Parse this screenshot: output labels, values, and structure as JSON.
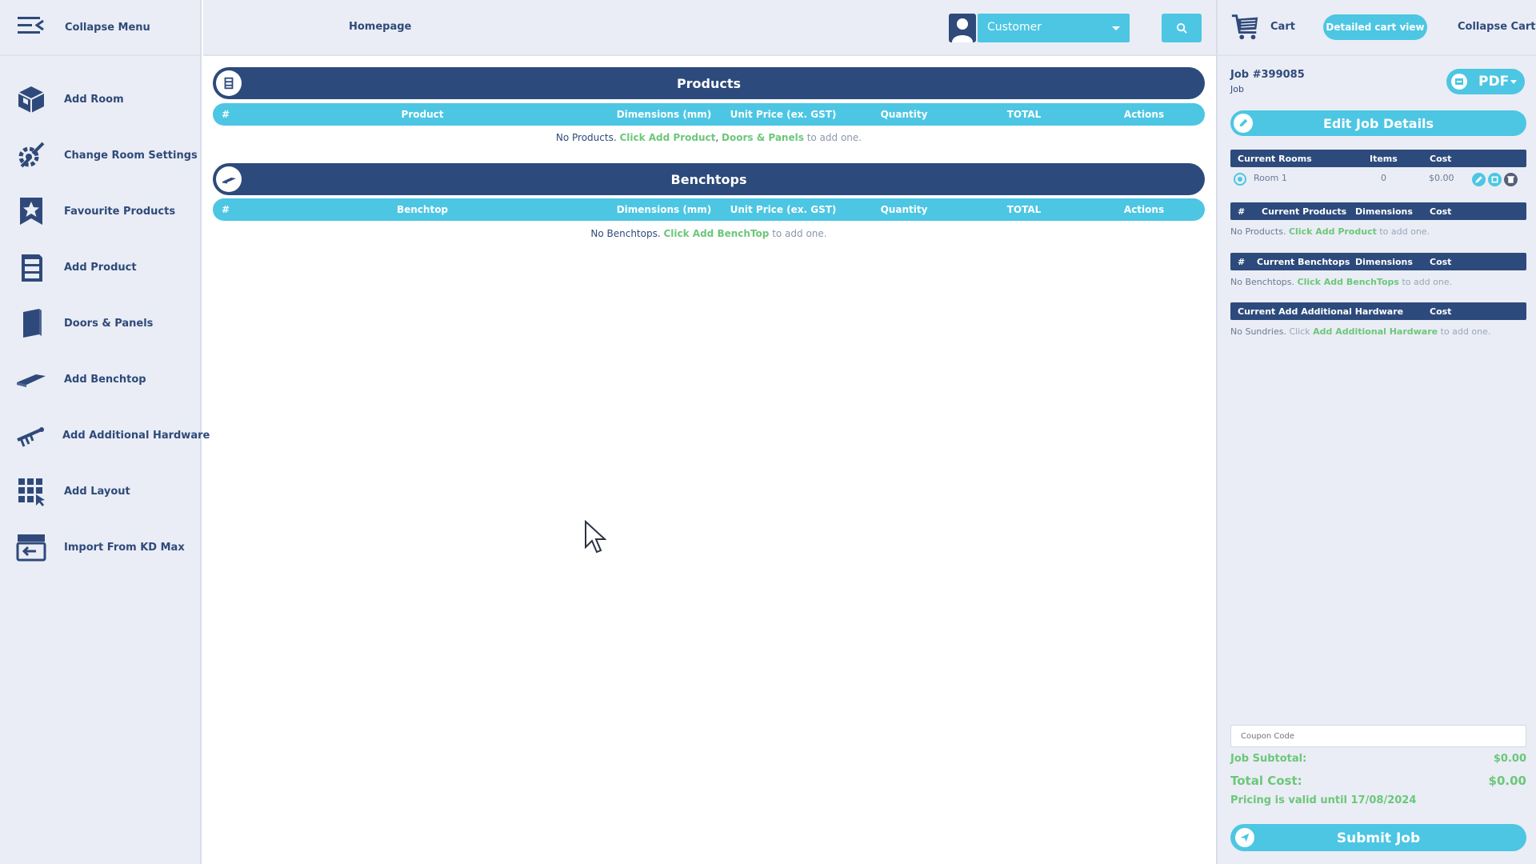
{
  "sidebar": {
    "collapse_label": "Collapse Menu",
    "items": [
      {
        "label": "Add Room",
        "icon": "cube-icon"
      },
      {
        "label": "Change Room Settings",
        "icon": "tools-icon"
      },
      {
        "label": "Favourite Products",
        "icon": "star-icon"
      },
      {
        "label": "Add Product",
        "icon": "cabinet-icon"
      },
      {
        "label": "Doors & Panels",
        "icon": "door-icon"
      },
      {
        "label": "Add Benchtop",
        "icon": "benchtop-icon"
      },
      {
        "label": "Add Additional Hardware",
        "icon": "hardware-icon"
      },
      {
        "label": "Add Layout",
        "icon": "grid-icon"
      },
      {
        "label": "Import From KD Max",
        "icon": "import-icon"
      }
    ]
  },
  "topbar": {
    "homepage": "Homepage",
    "customer_select": "Customer"
  },
  "products": {
    "title": "Products",
    "columns": [
      "#",
      "Product",
      "Dimensions (mm)",
      "Unit Price (ex. GST)",
      "Quantity",
      "TOTAL",
      "Actions"
    ],
    "empty": {
      "prefix": "No Products.",
      "link1": "Click Add Product",
      "sep": ",",
      "link2": "Doors & Panels",
      "suffix": "to add one."
    }
  },
  "benchtops": {
    "title": "Benchtops",
    "columns": [
      "#",
      "Benchtop",
      "Dimensions (mm)",
      "Unit Price (ex. GST)",
      "Quantity",
      "TOTAL",
      "Actions"
    ],
    "empty": {
      "prefix": "No Benchtops.",
      "link": "Click Add BenchTop",
      "suffix": "to add one."
    }
  },
  "cart": {
    "label": "Cart",
    "detailed_view": "Detailed cart view",
    "collapse": "Collapse Cart",
    "job_number": "Job #399085",
    "job_type": "Job",
    "pdf_label": "PDF",
    "edit_job": "Edit Job Details",
    "rooms": {
      "headers": [
        "Current Rooms",
        "Items",
        "Cost"
      ],
      "rows": [
        {
          "name": "Room 1",
          "items": "0",
          "cost": "$0.00"
        }
      ]
    },
    "current_products": {
      "headers": [
        "#",
        "Current Products",
        "Dimensions",
        "Cost"
      ],
      "empty": {
        "prefix": "No Products.",
        "link": "Click Add Product",
        "suffix": "to add one."
      }
    },
    "current_benchtops": {
      "headers": [
        "#",
        "Current Benchtops",
        "Dimensions",
        "Cost"
      ],
      "empty": {
        "prefix": "No Benchtops.",
        "link": "Click Add BenchTops",
        "suffix": "to add one."
      }
    },
    "hardware": {
      "headers": [
        "Current Add Additional Hardware",
        "Cost"
      ],
      "empty": {
        "prefix": "No Sundries.",
        "mid": "Click",
        "link": "Add Additional Hardware",
        "suffix": "to add one."
      }
    },
    "coupon_placeholder": "Coupon Code",
    "subtotal_label": "Job Subtotal:",
    "subtotal_value": "$0.00",
    "total_label": "Total Cost:",
    "total_value": "$0.00",
    "validity": "Pricing is valid until 17/08/2024",
    "submit": "Submit Job"
  },
  "colors": {
    "navy": "#2d4a7c",
    "cyan": "#4cc6e3",
    "green": "#6cc77a",
    "panel": "#eaedf5"
  }
}
